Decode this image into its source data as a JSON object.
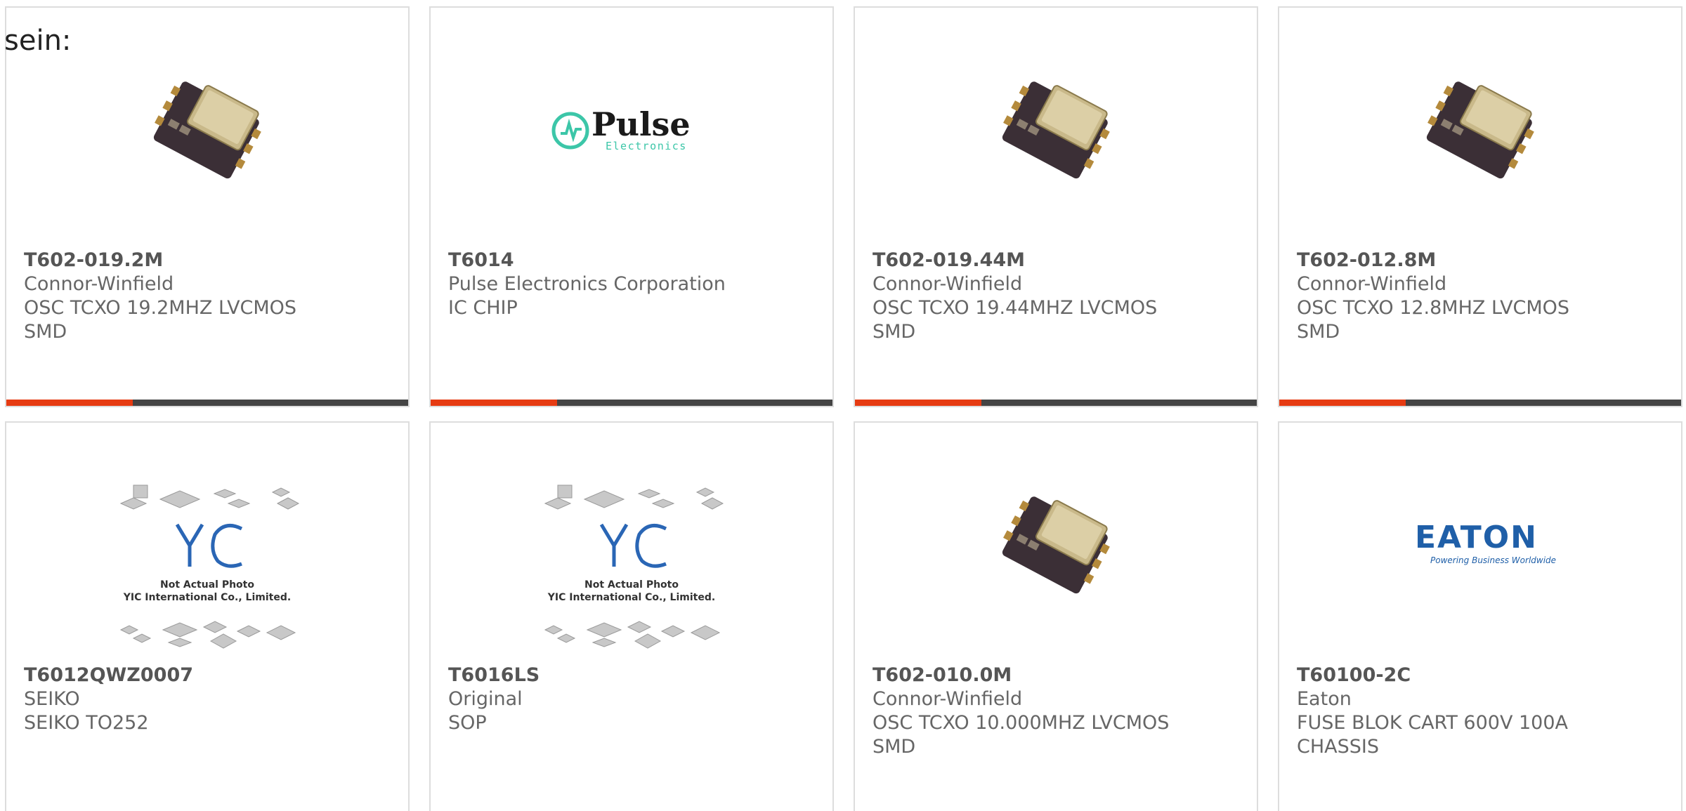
{
  "intro_text": "sein:",
  "colors": {
    "accent": "#e63b12",
    "bar_dark": "#444444",
    "card_border": "#dddddd",
    "text": "#666666",
    "pulse_green": "#3cc6a8",
    "eaton_blue": "#1f5fa8",
    "yic_blue": "#2a66b5"
  },
  "products": [
    {
      "part_number": "T602-019.2M",
      "manufacturer": "Connor-Winfield",
      "desc1": "OSC TCXO 19.2MHZ LVCMOS",
      "desc2": "SMD",
      "image": "oscillator-chip"
    },
    {
      "part_number": "T6014",
      "manufacturer": "Pulse Electronics Corporation",
      "desc1": "IC CHIP",
      "desc2": "",
      "image": "pulse-logo",
      "logo": {
        "brand": "Pulse",
        "sub": "Electronics"
      }
    },
    {
      "part_number": "T602-019.44M",
      "manufacturer": "Connor-Winfield",
      "desc1": "OSC TCXO 19.44MHZ LVCMOS",
      "desc2": "SMD",
      "image": "oscillator-chip"
    },
    {
      "part_number": "T602-012.8M",
      "manufacturer": "Connor-Winfield",
      "desc1": "OSC TCXO 12.8MHZ LVCMOS",
      "desc2": "SMD",
      "image": "oscillator-chip"
    },
    {
      "part_number": "T6012QWZ0007",
      "manufacturer": "SEIKO",
      "desc1": "SEIKO TO252",
      "desc2": "",
      "image": "not-actual-photo",
      "placeholder": {
        "line1": "Not Actual Photo",
        "line2": "YIC International Co., Limited."
      }
    },
    {
      "part_number": "T6016LS",
      "manufacturer": "Original",
      "desc1": "SOP",
      "desc2": "",
      "image": "not-actual-photo",
      "placeholder": {
        "line1": "Not Actual Photo",
        "line2": "YIC International Co., Limited."
      }
    },
    {
      "part_number": "T602-010.0M",
      "manufacturer": "Connor-Winfield",
      "desc1": "OSC TCXO 10.000MHZ LVCMOS",
      "desc2": "SMD",
      "image": "oscillator-chip"
    },
    {
      "part_number": "T60100-2C",
      "manufacturer": "Eaton",
      "desc1": "FUSE BLOK CART 600V 100A",
      "desc2": "CHASSIS",
      "image": "eaton-logo",
      "logo": {
        "brand": "EATON",
        "tagline": "Powering Business Worldwide"
      }
    }
  ]
}
